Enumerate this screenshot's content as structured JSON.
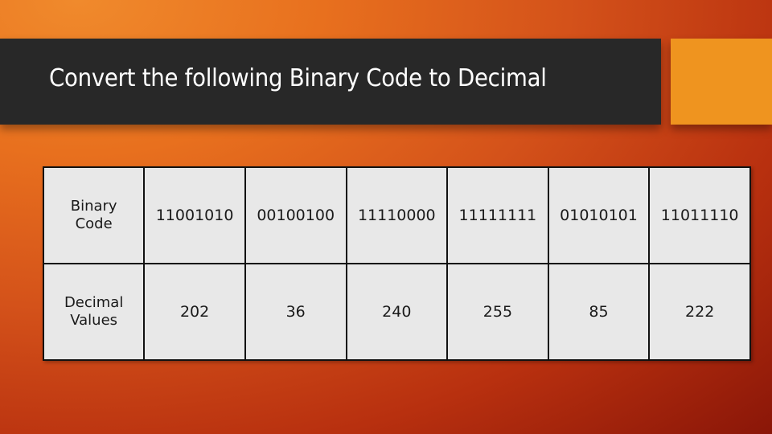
{
  "slide": {
    "title": "Convert the following Binary Code to Decimal",
    "colors": {
      "title_bar": "#282828",
      "accent_block": "#ef941f",
      "table_fill": "#e8e8e8"
    }
  },
  "table": {
    "rows": [
      {
        "header": "Binary Code",
        "cells": [
          "11001010",
          "00100100",
          "11110000",
          "11111111",
          "01010101",
          "11011110"
        ]
      },
      {
        "header": "Decimal Values",
        "cells": [
          "202",
          "36",
          "240",
          "255",
          "85",
          "222"
        ]
      }
    ]
  }
}
